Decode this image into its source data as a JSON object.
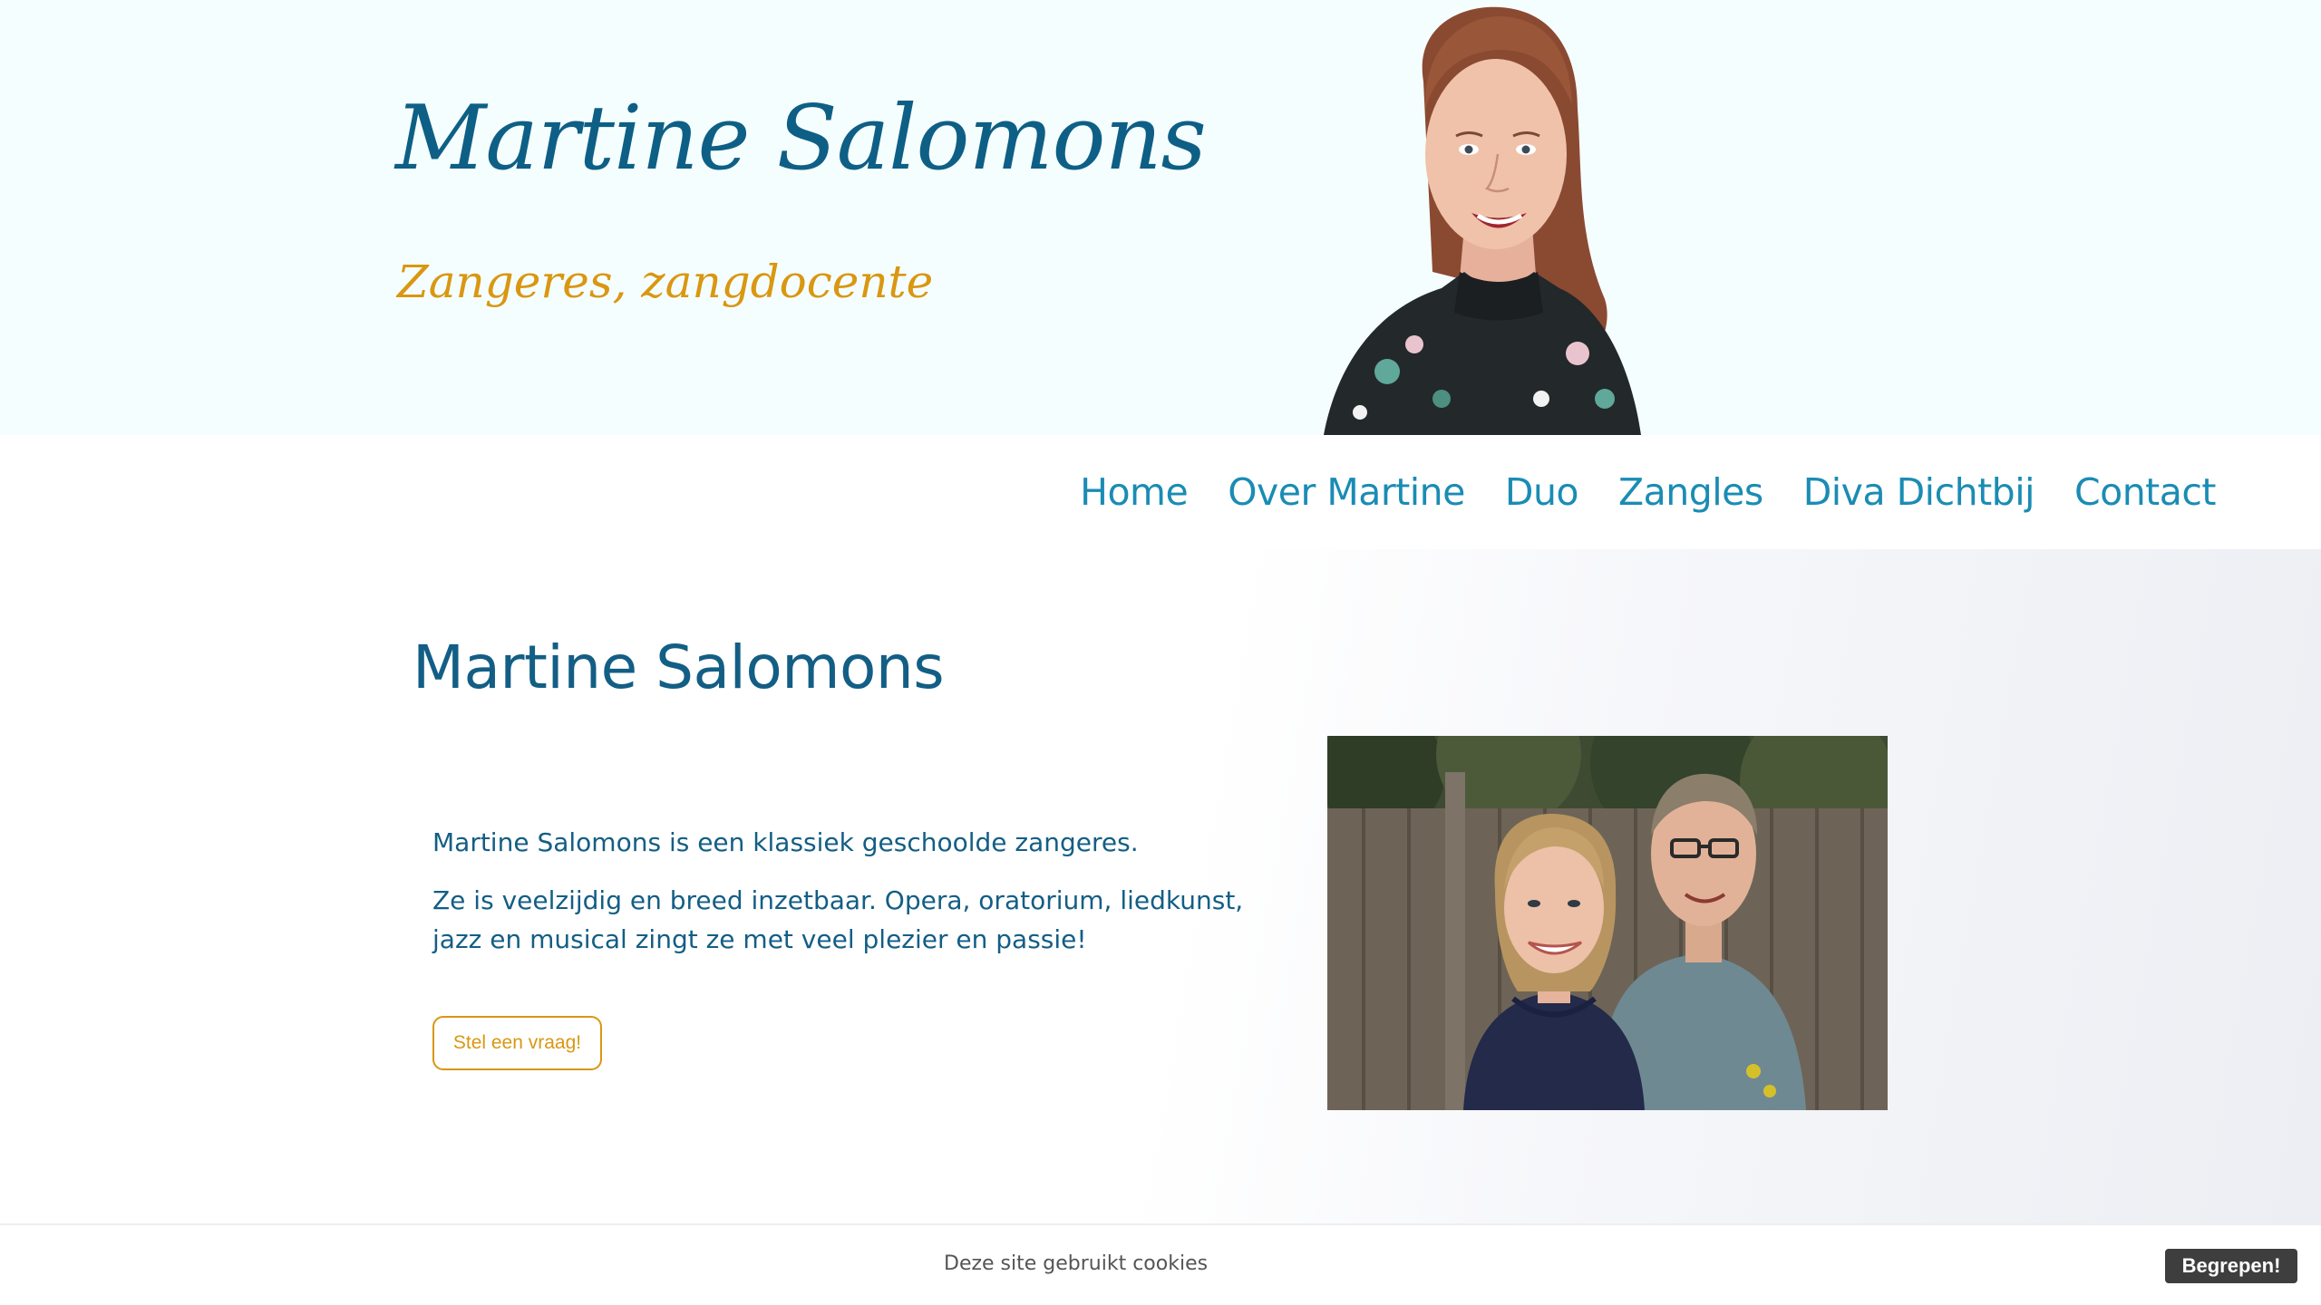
{
  "header": {
    "title": "Martine Salomons",
    "tagline": "Zangeres, zangdocente"
  },
  "nav": {
    "items": [
      {
        "label": "Home"
      },
      {
        "label": "Over Martine"
      },
      {
        "label": "Duo"
      },
      {
        "label": "Zangles"
      },
      {
        "label": "Diva Dichtbij"
      },
      {
        "label": "Contact"
      }
    ]
  },
  "main": {
    "title": "Martine Salomons",
    "paragraphs": [
      "Martine Salomons is een klassiek geschoolde zangeres.",
      "Ze is veelzijdig en breed inzetbaar. Opera, oratorium, liedkunst, jazz en musical zingt ze met veel plezier en passie!"
    ],
    "cta_label": "Stel een vraag!"
  },
  "cookie": {
    "text": "Deze site gebruikt cookies",
    "button_label": "Begrepen!"
  },
  "colors": {
    "brand": "#0e5f85",
    "nav": "#1a8cb4",
    "accent": "#d99712",
    "header_bg": "#f5fefe"
  }
}
